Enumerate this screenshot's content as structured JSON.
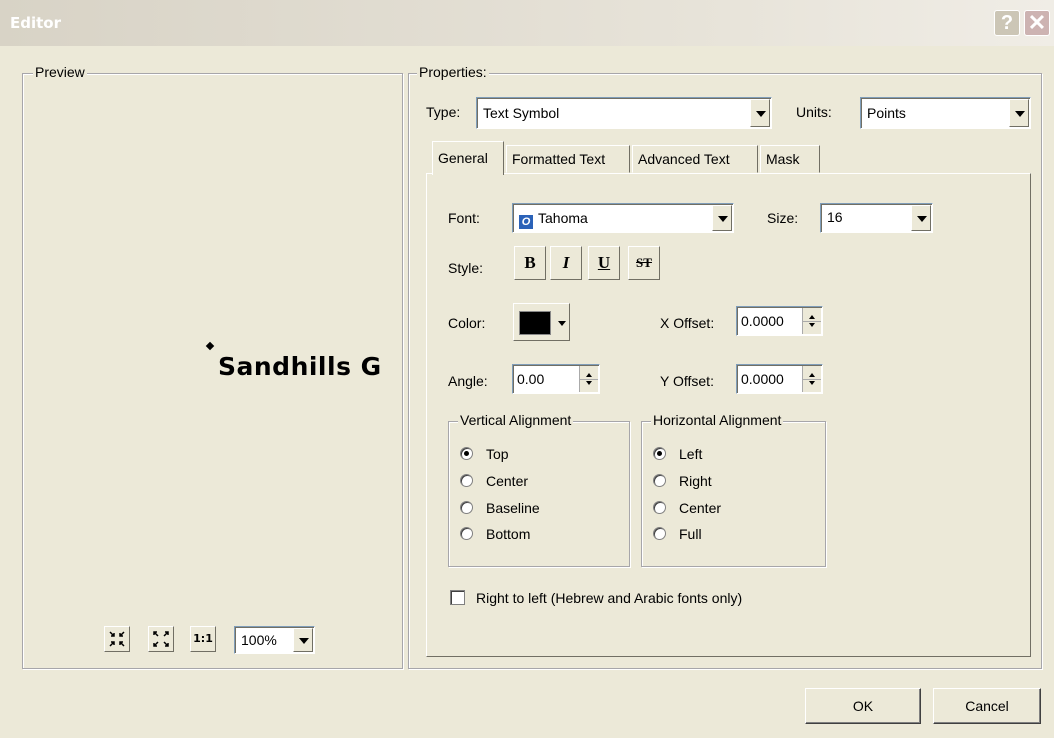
{
  "window": {
    "title": "Editor",
    "help_glyph": "?",
    "close_glyph": "✕"
  },
  "preview": {
    "legend": "Preview",
    "sample_text": "Sandhills G",
    "tools": [
      {
        "name": "zoom-in-icon",
        "glyph": "⁘"
      },
      {
        "name": "zoom-out-icon",
        "glyph": "⛶"
      },
      {
        "name": "actual-size-icon",
        "glyph": "1:1"
      }
    ],
    "zoom_value": "100%"
  },
  "properties": {
    "legend": "Properties:",
    "type_label": "Type:",
    "type_value": "Text Symbol",
    "units_label": "Units:",
    "units_value": "Points"
  },
  "tabs": [
    {
      "label": "General",
      "active": true
    },
    {
      "label": "Formatted Text",
      "active": false
    },
    {
      "label": "Advanced Text",
      "active": false
    },
    {
      "label": "Mask",
      "active": false
    }
  ],
  "general": {
    "font_label": "Font:",
    "font_value": "Tahoma",
    "font_icon": "O",
    "size_label": "Size:",
    "size_value": "16",
    "style_label": "Style:",
    "style_buttons": [
      "B",
      "I",
      "U",
      "ST"
    ],
    "color_label": "Color:",
    "color_value": "#000000",
    "x_offset_label": "X Offset:",
    "x_offset_value": "0.0000",
    "angle_label": "Angle:",
    "angle_value": "0.00",
    "y_offset_label": "Y Offset:",
    "y_offset_value": "0.0000",
    "vertical_alignment": {
      "legend": "Vertical Alignment",
      "options": [
        "Top",
        "Center",
        "Baseline",
        "Bottom"
      ],
      "selected": "Top"
    },
    "horizontal_alignment": {
      "legend": "Horizontal Alignment",
      "options": [
        "Left",
        "Right",
        "Center",
        "Full"
      ],
      "selected": "Left"
    },
    "rtl_label": "Right to left (Hebrew and Arabic fonts only)",
    "rtl_checked": false
  },
  "buttons": {
    "ok": "OK",
    "cancel": "Cancel"
  }
}
